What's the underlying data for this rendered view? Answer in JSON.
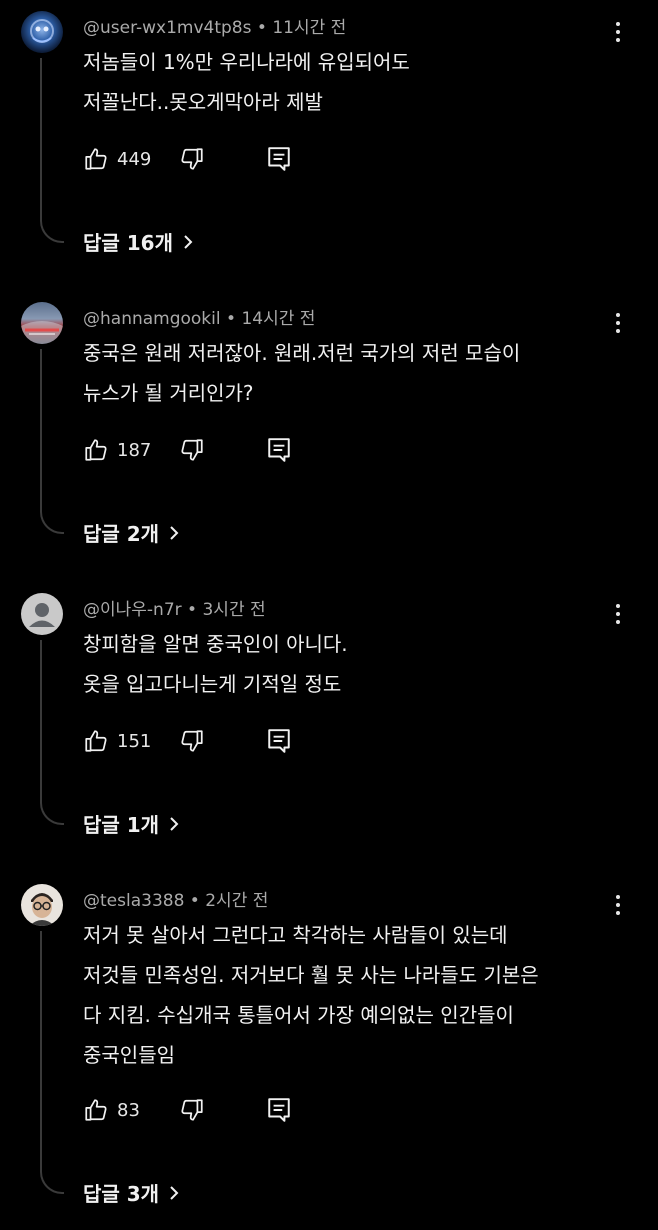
{
  "comments": [
    {
      "user": "@user-wx1mv4tp8s",
      "time": "11시간 전",
      "text": "저놈들이 1%만 우리나라에 유입되어도\n저꼴난다..못오게막아라 제발",
      "likes": "449",
      "replies": "답글 16개",
      "avatar": "blue-orb-avatar"
    },
    {
      "user": "@hannamgookil",
      "time": "14시간 전",
      "text": "중국은 원래 저러잖아. 원래.저런 국가의 저런 모습이\n뉴스가 될 거리인가?",
      "likes": "187",
      "replies": "답글 2개",
      "avatar": "stadium-photo-avatar"
    },
    {
      "user": "@이나우-n7r",
      "time": "3시간 전",
      "text": "창피함을 알면 중국인이 아니다.\n옷을 입고다니는게 기적일 정도",
      "likes": "151",
      "replies": "답글 1개",
      "avatar": "default-person-avatar"
    },
    {
      "user": "@tesla3388",
      "time": "2시간 전",
      "text": "저거 못 살아서 그런다고 착각하는 사람들이 있는데\n저것들 민족성임. 저거보다 훨 못 사는 나라들도 기본은\n다 지킴. 수십개국 통틀어서 가장 예의없는 인간들이\n중국인들임",
      "likes": "83",
      "replies": "답글 3개",
      "avatar": "glasses-person-avatar"
    }
  ],
  "separator": " • ",
  "icons": {
    "like": "thumbs-up-icon",
    "dislike": "thumbs-down-icon",
    "reply": "reply-comment-icon",
    "more": "more-vert-icon",
    "chevron": "chevron-right-icon"
  }
}
